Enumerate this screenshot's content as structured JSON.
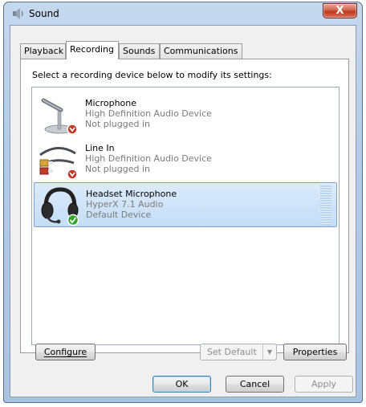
{
  "window": {
    "title": "Sound",
    "close_label": "X"
  },
  "tabs": [
    {
      "label": "Playback",
      "active": false
    },
    {
      "label": "Recording",
      "active": true
    },
    {
      "label": "Sounds",
      "active": false
    },
    {
      "label": "Communications",
      "active": false
    }
  ],
  "panel": {
    "instruction": "Select a recording device below to modify its settings:"
  },
  "devices": [
    {
      "name": "Microphone",
      "driver": "High Definition Audio Device",
      "status": "Not plugged in",
      "icon": "microphone-icon",
      "badge": "unplugged-badge-icon",
      "selected": false
    },
    {
      "name": "Line In",
      "driver": "High Definition Audio Device",
      "status": "Not plugged in",
      "icon": "line-in-cable-icon",
      "badge": "unplugged-badge-icon",
      "selected": false
    },
    {
      "name": "Headset Microphone",
      "driver": "HyperX 7.1 Audio",
      "status": "Default Device",
      "icon": "headset-icon",
      "badge": "default-checkmark-icon",
      "selected": true
    }
  ],
  "buttons": {
    "configure": "Configure",
    "set_default": "Set Default",
    "properties": "Properties",
    "ok": "OK",
    "cancel": "Cancel",
    "apply": "Apply"
  },
  "colors": {
    "selection_bg": "#c4ddf6",
    "selection_border": "#7da2ce",
    "frame": "#b3cbe7",
    "close_button": "#c0381f"
  }
}
